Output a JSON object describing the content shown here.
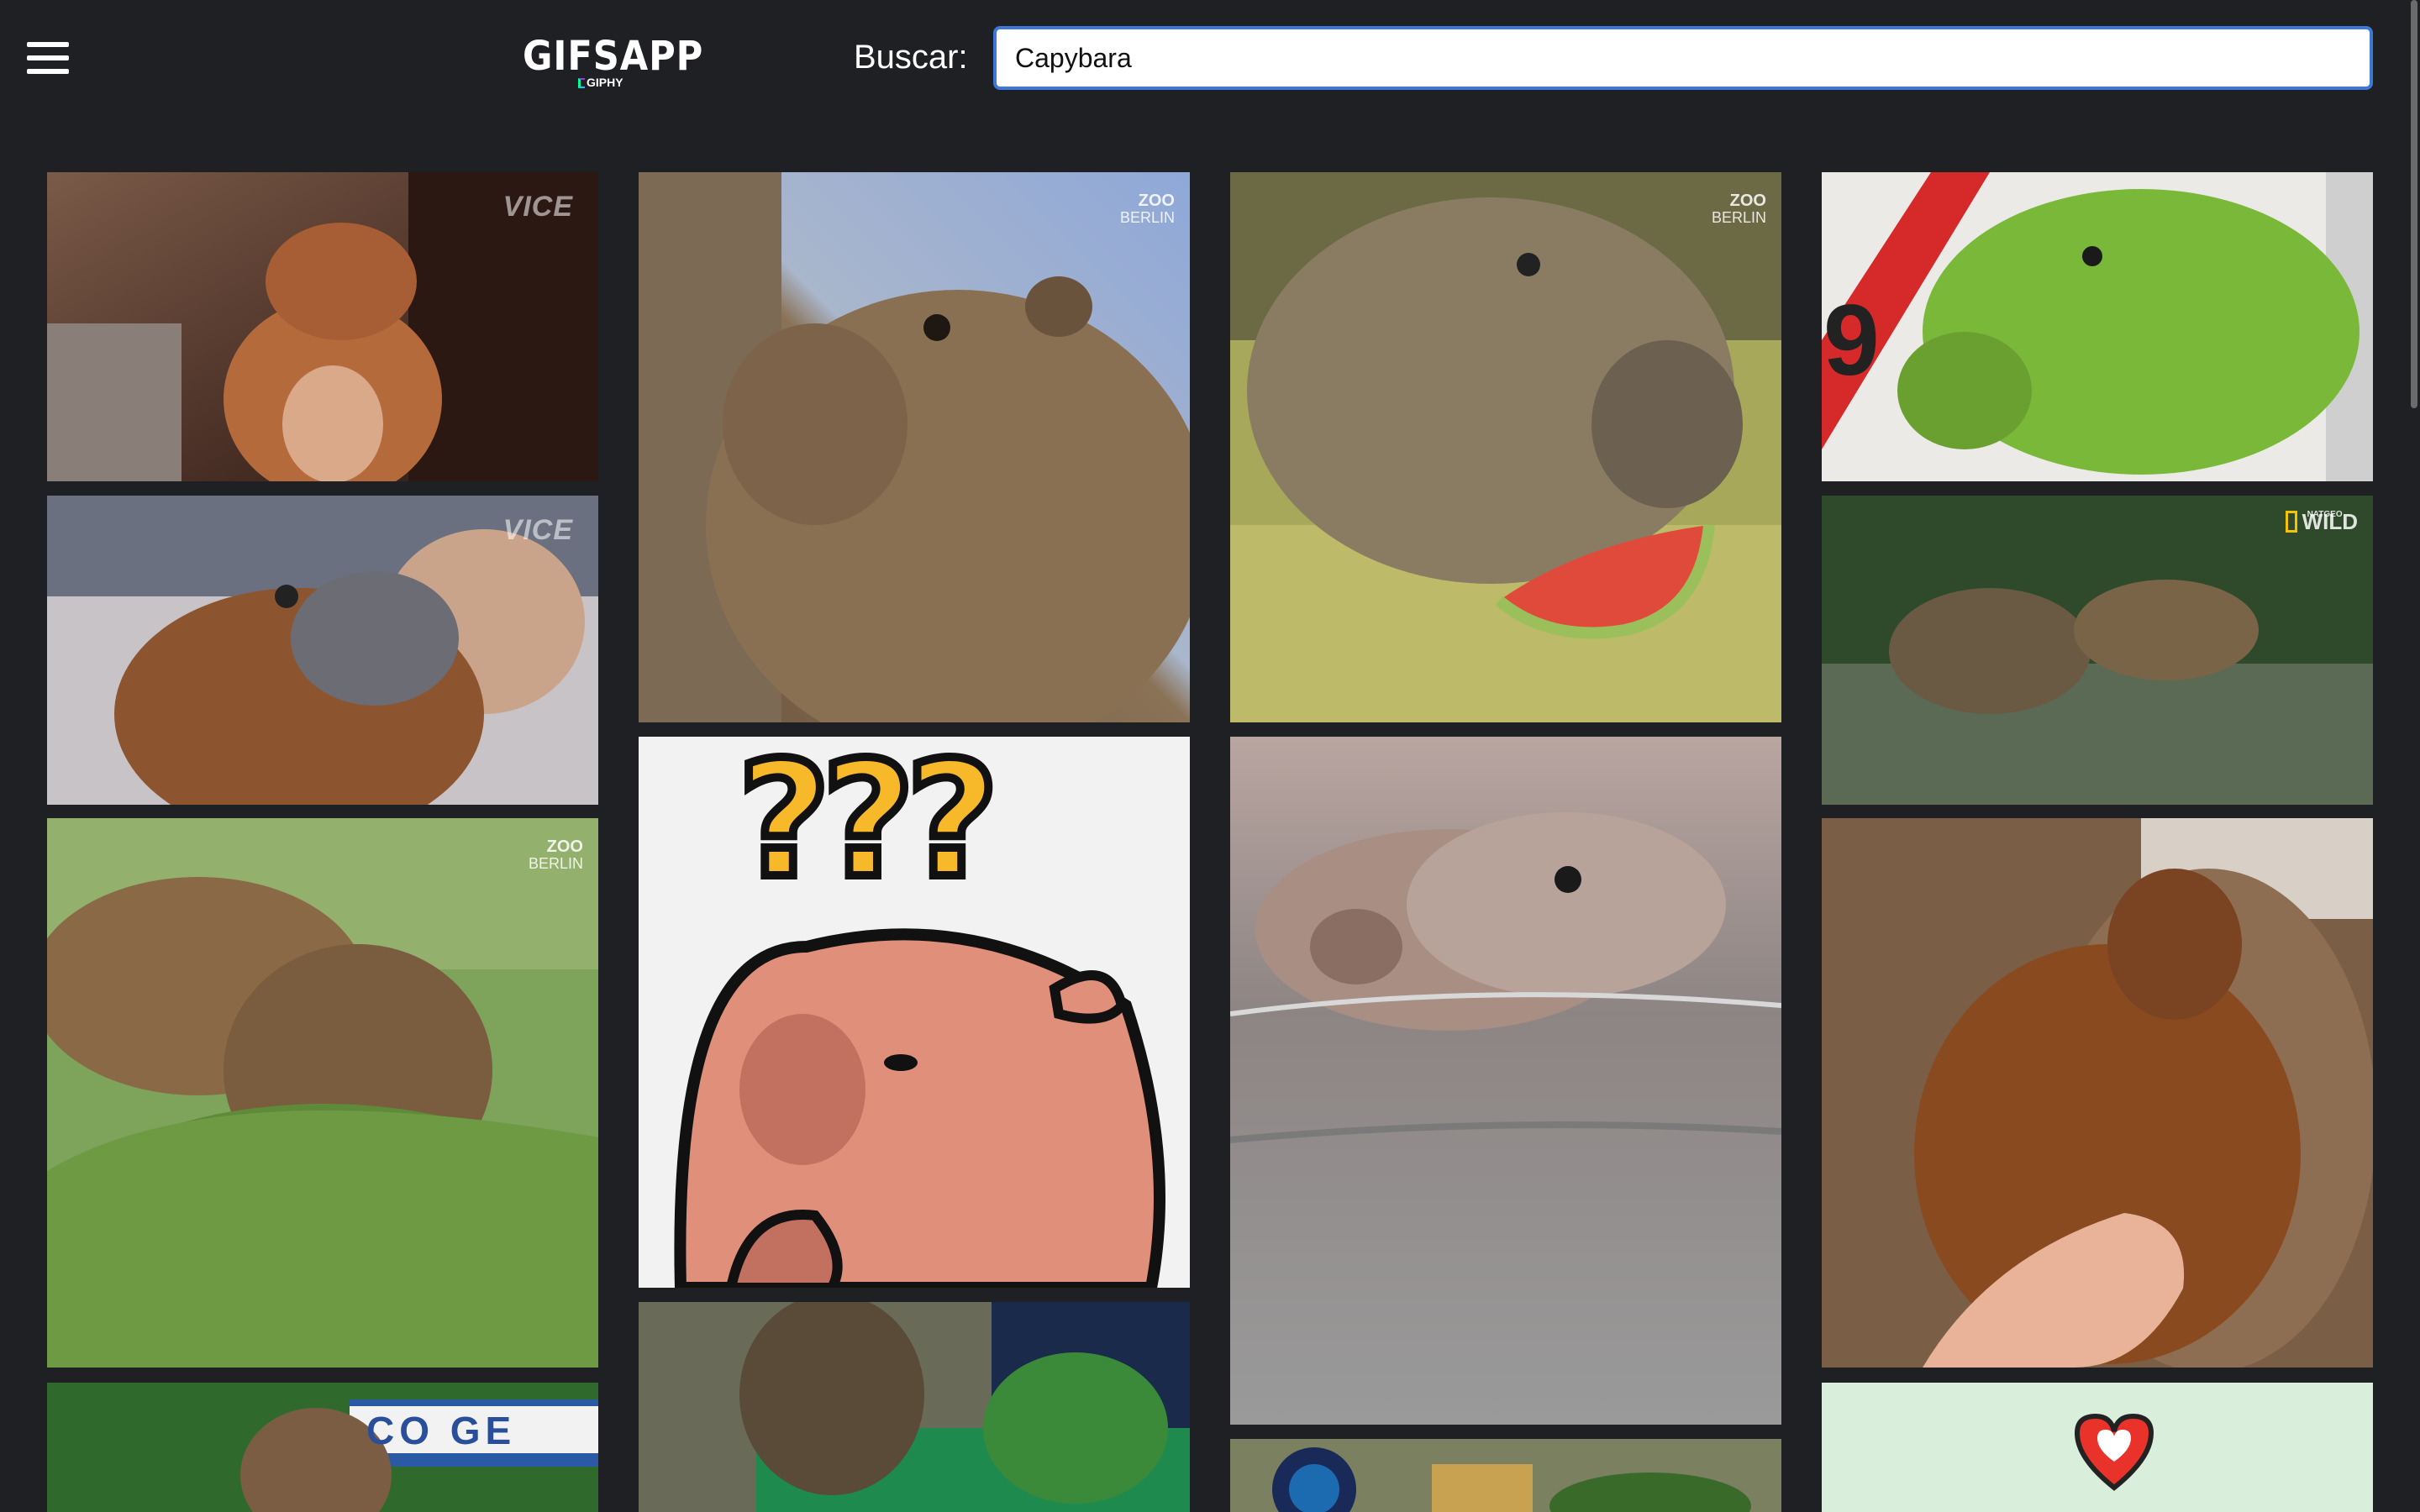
{
  "header": {
    "logo_title": "GIFSAPP",
    "logo_sub": "GIPHY",
    "search_label": "Buscar:",
    "search_value": "Capybara"
  },
  "icons": {
    "menu": "hamburger-menu-icon",
    "giphy": "giphy-logo-icon"
  },
  "colors": {
    "background": "#1f2023",
    "input_border": "#3b78d8",
    "text": "#ffffff"
  },
  "gifs": [
    {
      "alt": "Capybara sitting by rocks",
      "watermark": "VICE"
    },
    {
      "alt": "Capybara looking back",
      "watermark": "VICE"
    },
    {
      "alt": "Capybaras eating willow leaves",
      "watermark_line1": "ZOO",
      "watermark_line2": "BERLIN"
    },
    {
      "alt": "Capybara in front of wall",
      "watermark": "CO GE"
    },
    {
      "alt": "Close-up of capybara face",
      "watermark_line1": "ZOO",
      "watermark_line2": "BERLIN"
    },
    {
      "alt": "Cartoon capybara with question marks",
      "caption": "???"
    },
    {
      "alt": "Capybara on green floor"
    },
    {
      "alt": "Capybara eating watermelon",
      "watermark_line1": "ZOO",
      "watermark_line2": "BERLIN"
    },
    {
      "alt": "Capybara swimming"
    },
    {
      "alt": "Capybara with plants"
    },
    {
      "alt": "Green capybara",
      "watermark": "9"
    },
    {
      "alt": "Capybaras in water",
      "watermark_small": "NATGEO",
      "watermark": "WILD"
    },
    {
      "alt": "Capybara being petted on couch"
    },
    {
      "alt": "Heart sticker"
    }
  ]
}
